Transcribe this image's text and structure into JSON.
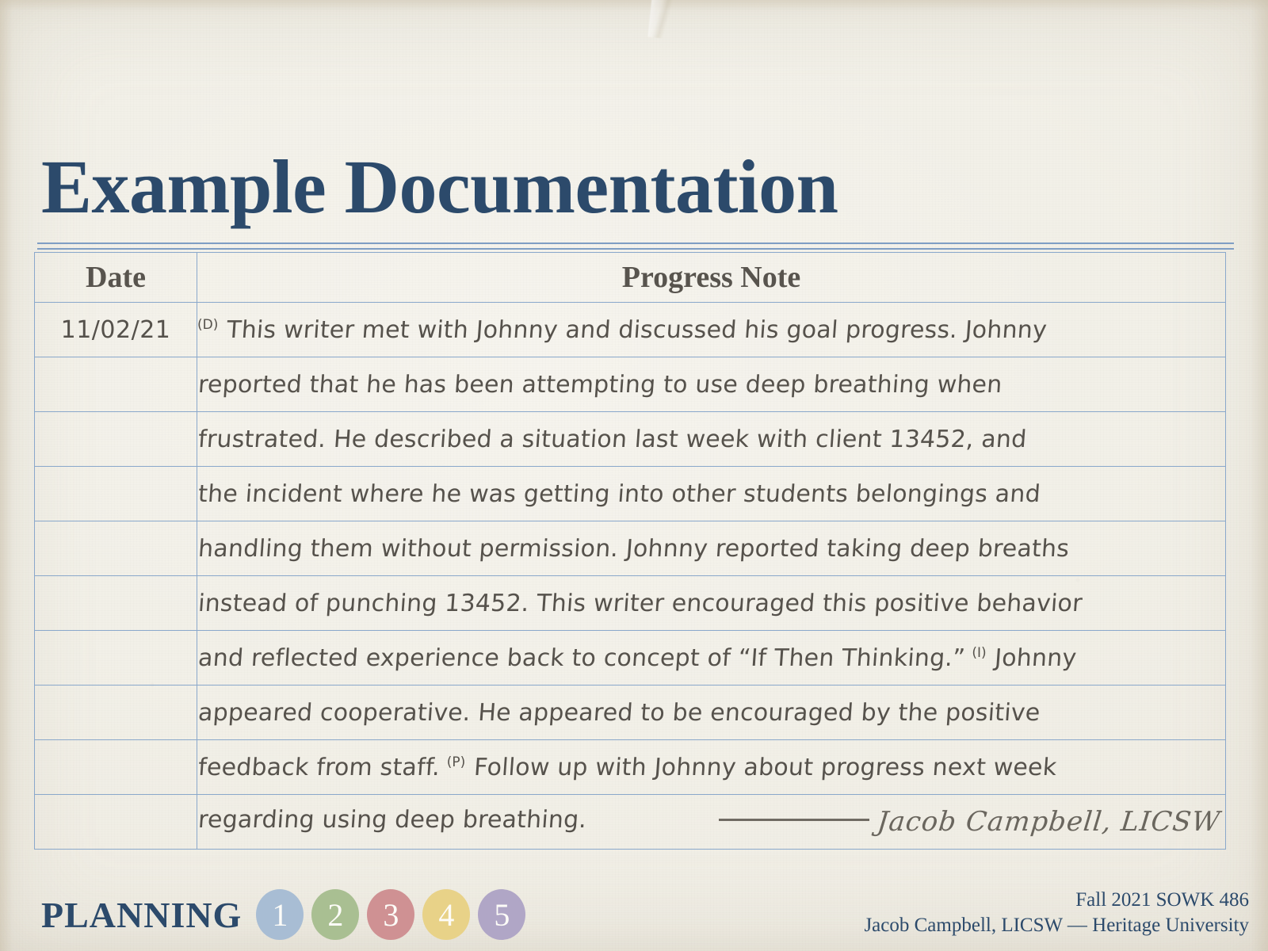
{
  "slide": {
    "title": "Example Documentation",
    "background_color": "#f2f0e8",
    "accent_color": "#2c4a6b",
    "table_border_color": "#8aa8cb"
  },
  "table": {
    "headers": {
      "date": "Date",
      "note": "Progress Note"
    },
    "date_value": "11/02/21",
    "rows": [
      {
        "date": "11/02/21",
        "marker": "(D)",
        "text": "This writer met with Johnny and discussed his goal progress. Johnny"
      },
      {
        "date": "",
        "marker": "",
        "text": "reported that he has been attempting to use deep breathing when"
      },
      {
        "date": "",
        "marker": "",
        "text": "frustrated. He described a  situation last week with client 13452, and"
      },
      {
        "date": "",
        "marker": "",
        "text": "the incident where he was getting into other students belongings and"
      },
      {
        "date": "",
        "marker": "",
        "text": "handling them without permission. Johnny reported taking deep breaths"
      },
      {
        "date": "",
        "marker": "",
        "text": "instead of punching 13452. This writer encouraged this positive behavior"
      },
      {
        "date": "",
        "marker": "",
        "text": "and reflected experience back to concept of “If Then Thinking.”",
        "marker_end": "(I)",
        "text_end": "Johnny"
      },
      {
        "date": "",
        "marker": "",
        "text": "appeared cooperative. He appeared to be encouraged by the positive"
      },
      {
        "date": "",
        "marker": "",
        "text": "feedback from staff.",
        "marker_mid": "(P)",
        "text_mid": "Follow up with Johnny about progress next week"
      },
      {
        "date": "",
        "marker": "",
        "text": "regarding using deep breathing.",
        "signature": "Jacob Campbell, LICSW"
      }
    ]
  },
  "footer": {
    "planning_label": "PLANNING",
    "steps": [
      {
        "number": "1",
        "color": "#a8bdd4"
      },
      {
        "number": "2",
        "color": "#a9bf92"
      },
      {
        "number": "3",
        "color": "#cf9193"
      },
      {
        "number": "4",
        "color": "#e8d288"
      },
      {
        "number": "5",
        "color": "#b0a6c6"
      }
    ],
    "course_line": "Fall 2021 SOWK 486",
    "attribution_line": "Jacob Campbell, LICSW — Heritage University"
  }
}
